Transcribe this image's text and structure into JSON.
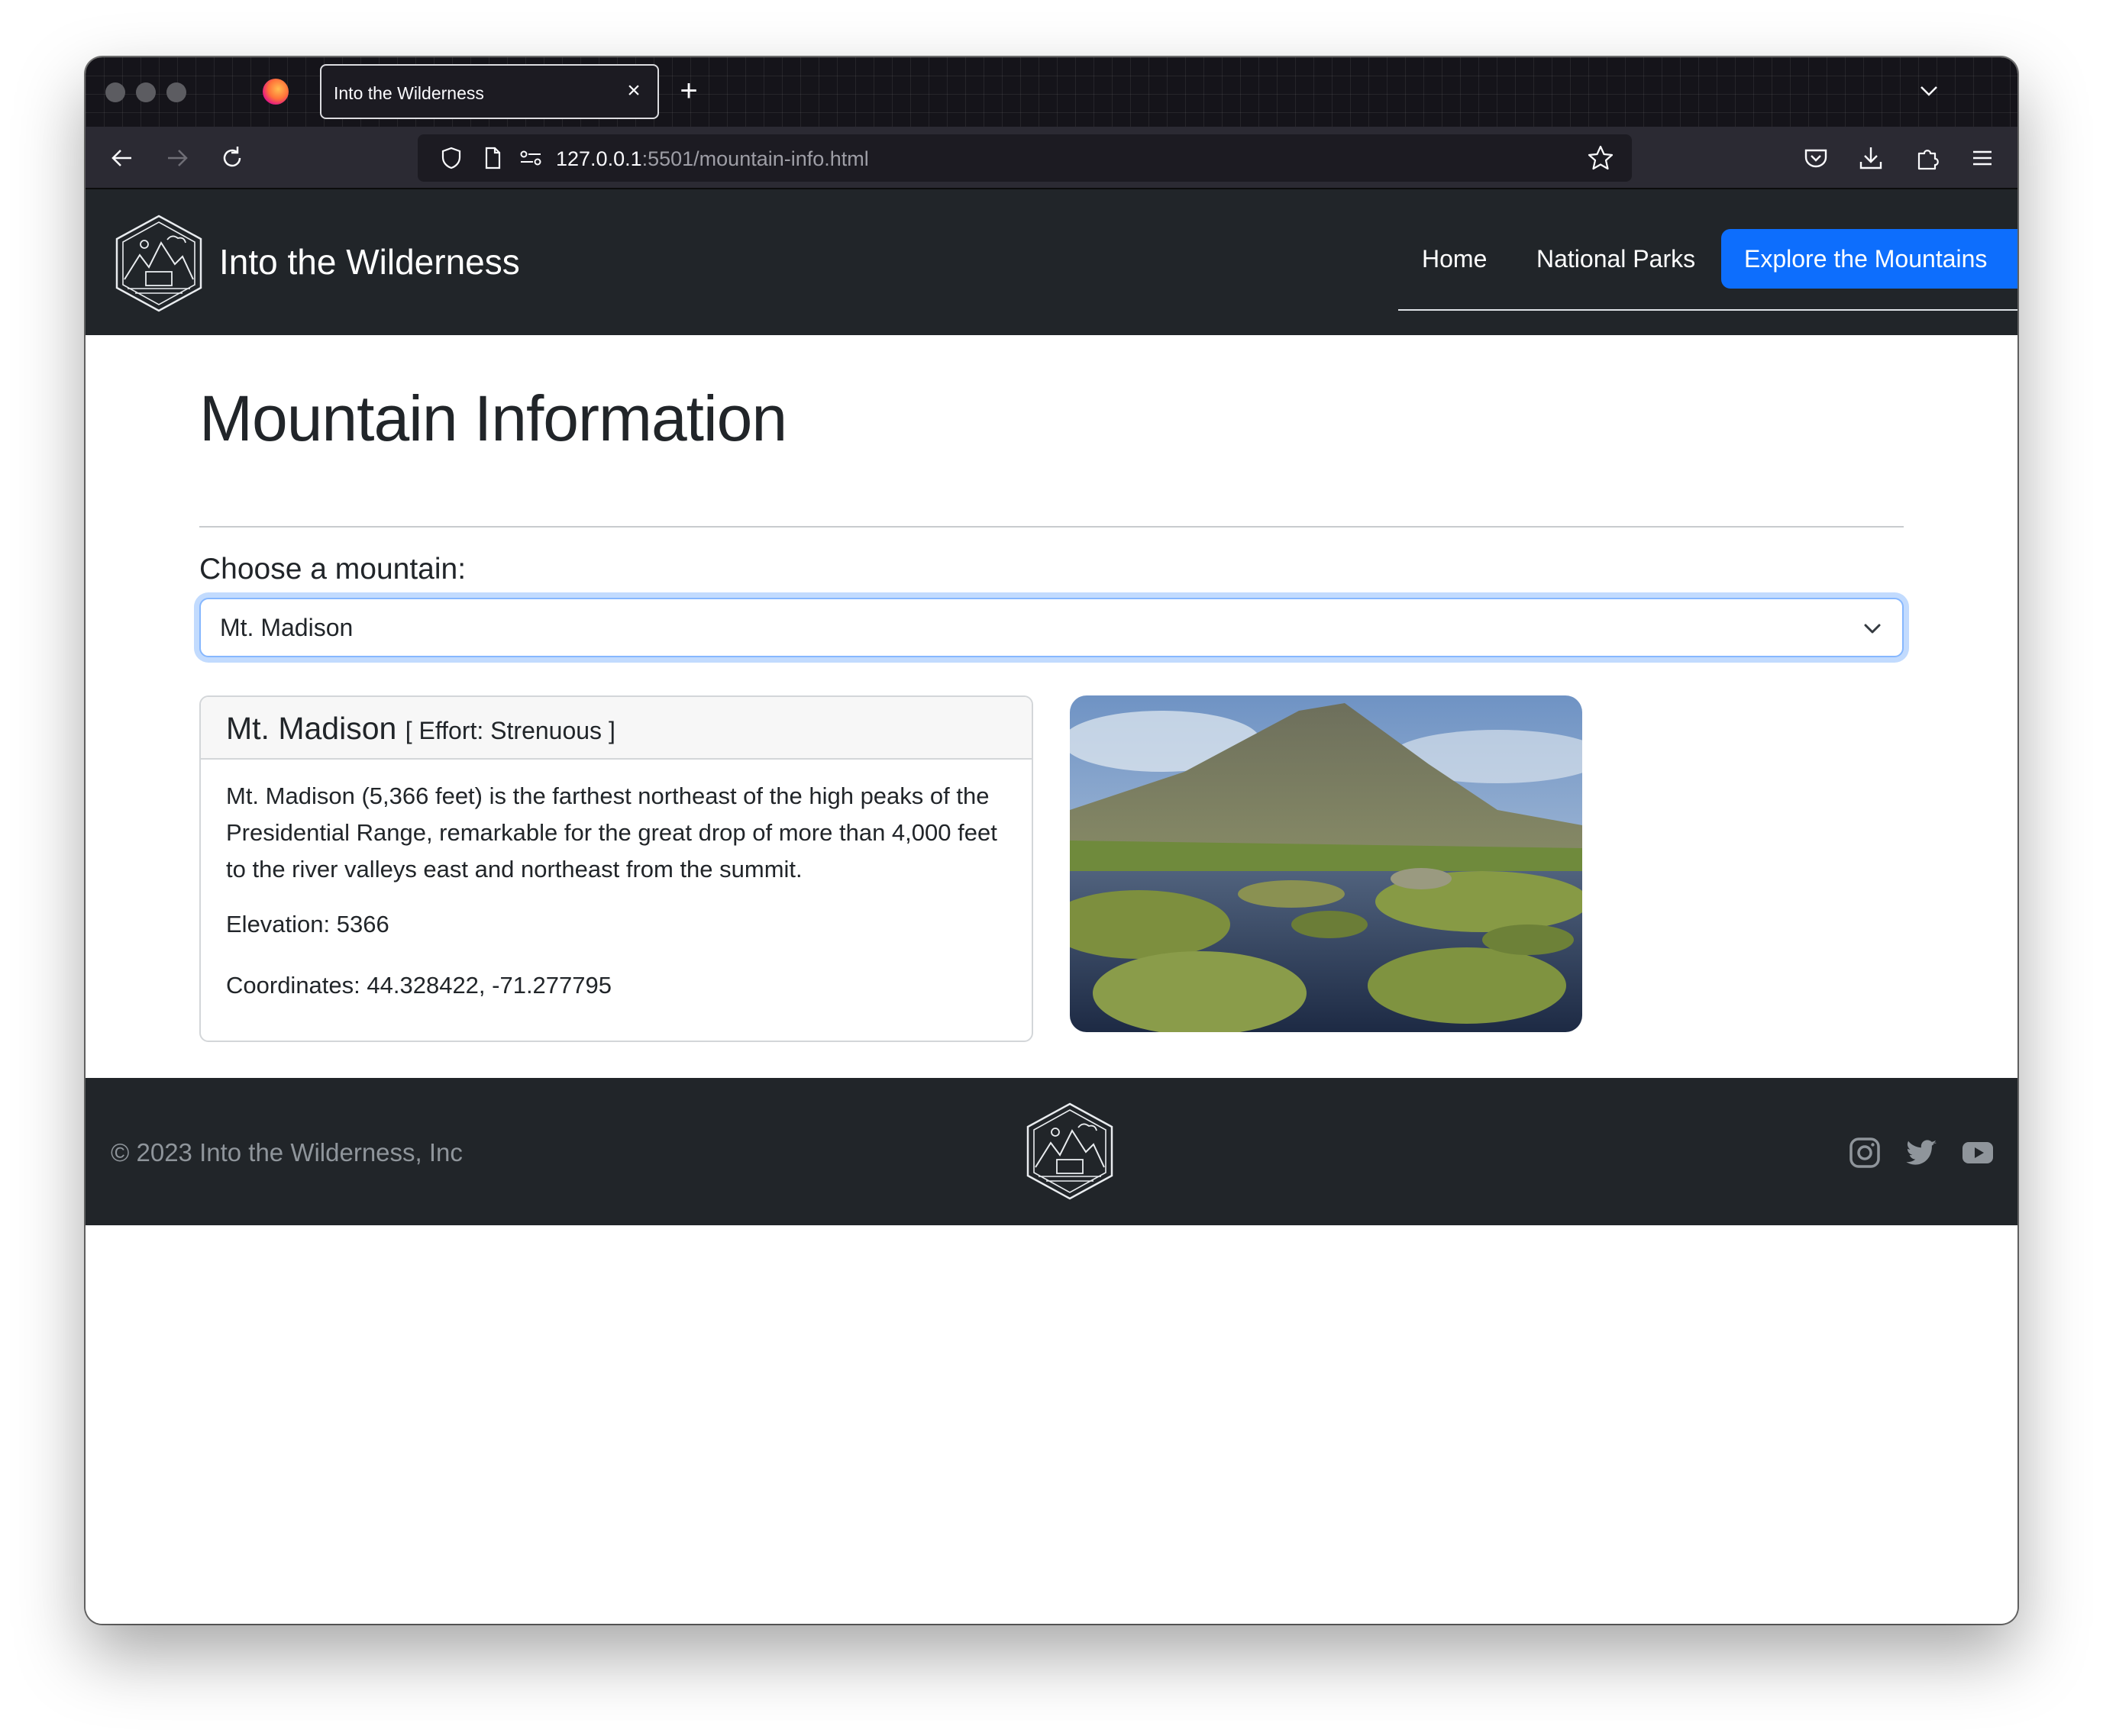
{
  "browser": {
    "tab_title": "Into the Wilderness",
    "url_host": "127.0.0.1",
    "url_rest": ":5501/mountain-info.html"
  },
  "site": {
    "brand": "Into the Wilderness",
    "nav": {
      "home": "Home",
      "parks": "National Parks",
      "mountains": "Explore the Mountains"
    }
  },
  "page": {
    "title": "Mountain Information",
    "choose_label": "Choose a mountain:",
    "selected_mountain": "Mt. Madison"
  },
  "mountain": {
    "name": "Mt. Madison",
    "effort": "[ Effort: Strenuous ]",
    "description": "Mt. Madison (5,366 feet) is the farthest northeast of the high peaks of the Presidential Range, remarkable for the great drop of more than 4,000 feet to the river valleys east and northeast from the summit.",
    "elevation": "Elevation: 5366",
    "coordinates": "Coordinates: 44.328422, -71.277795"
  },
  "footer": {
    "copyright": "© 2023 Into the Wilderness, Inc",
    "social": [
      "instagram-icon",
      "twitter-icon",
      "youtube-icon"
    ]
  },
  "colors": {
    "dark": "#212529",
    "accent": "#0d6efd",
    "focus_ring": "#86b7fe"
  }
}
